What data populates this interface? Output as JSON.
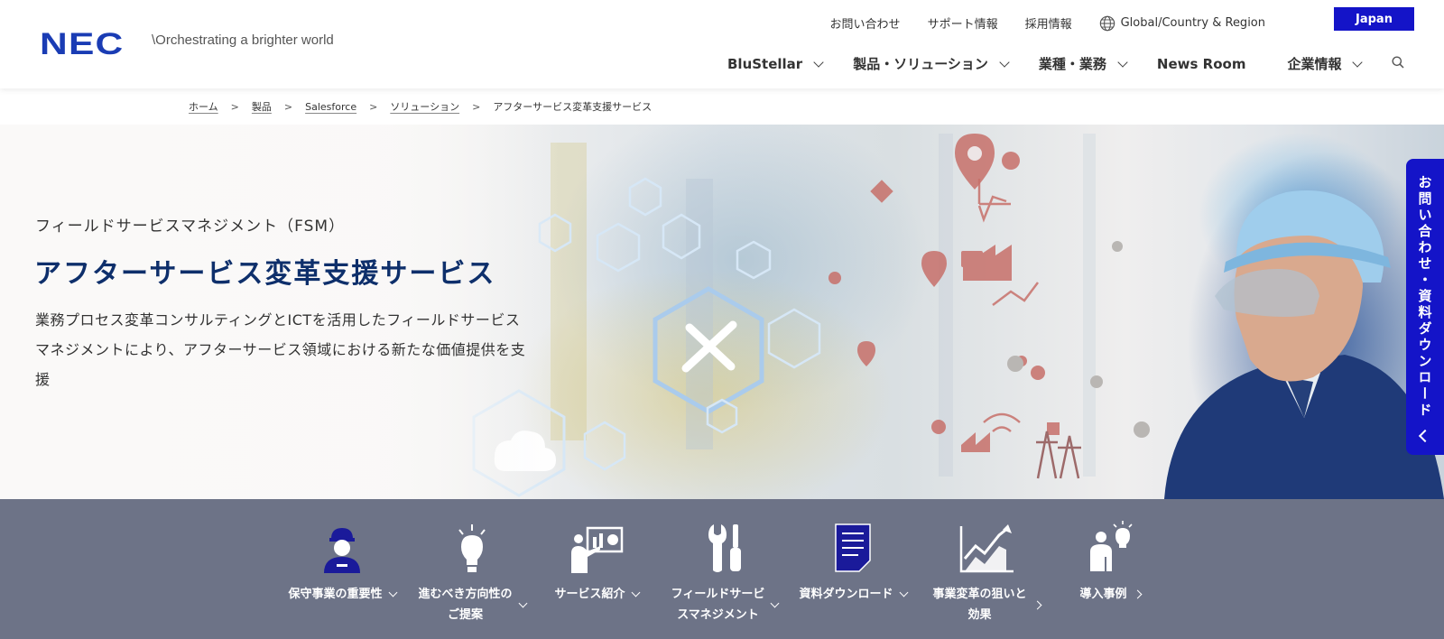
{
  "header": {
    "logo": "NEC",
    "tagline": "\\Orchestrating a brighter world",
    "utility_links": [
      "お問い合わせ",
      "サポート情報",
      "採用情報",
      "Global/Country & Region"
    ],
    "region_button": "Japan",
    "nav": [
      "BluStellar",
      "製品・ソリューション",
      "業種・業務",
      "News Room",
      "企業情報"
    ]
  },
  "breadcrumb": [
    "ホーム",
    "製品",
    "Salesforce",
    "ソリューション",
    "アフターサービス変革支援サービス"
  ],
  "hero": {
    "subtitle": "フィールドサービスマネジメント（FSM）",
    "title": "アフターサービス変革支援サービス",
    "description": "業務プロセス変革コンサルティングとICTを活用したフィールドサービスマネジメントにより、アフターサービス領域における新たな価値提供を支援"
  },
  "side_tab": {
    "label": "お問い合わせ・資料ダウンロード"
  },
  "bottom_nav": [
    {
      "label": "保守事業の重要性",
      "icon": "worker-icon"
    },
    {
      "label": "進むべき方向性の\nご提案",
      "icon": "lightbulb-icon"
    },
    {
      "label": "サービス紹介",
      "icon": "presentation-icon"
    },
    {
      "label": "フィールドサービ\nスマネジメント",
      "icon": "tools-icon"
    },
    {
      "label": "資料ダウンロード",
      "icon": "document-icon"
    },
    {
      "label": "事業変革の狙いと\n効果",
      "icon": "growth-chart-icon"
    },
    {
      "label": "導入事例",
      "icon": "idea-person-icon"
    }
  ],
  "colors": {
    "brand": "#1a3cb4",
    "accent": "#1414c8",
    "nav_bg": "#6d7387",
    "title": "#0e2f6b"
  }
}
